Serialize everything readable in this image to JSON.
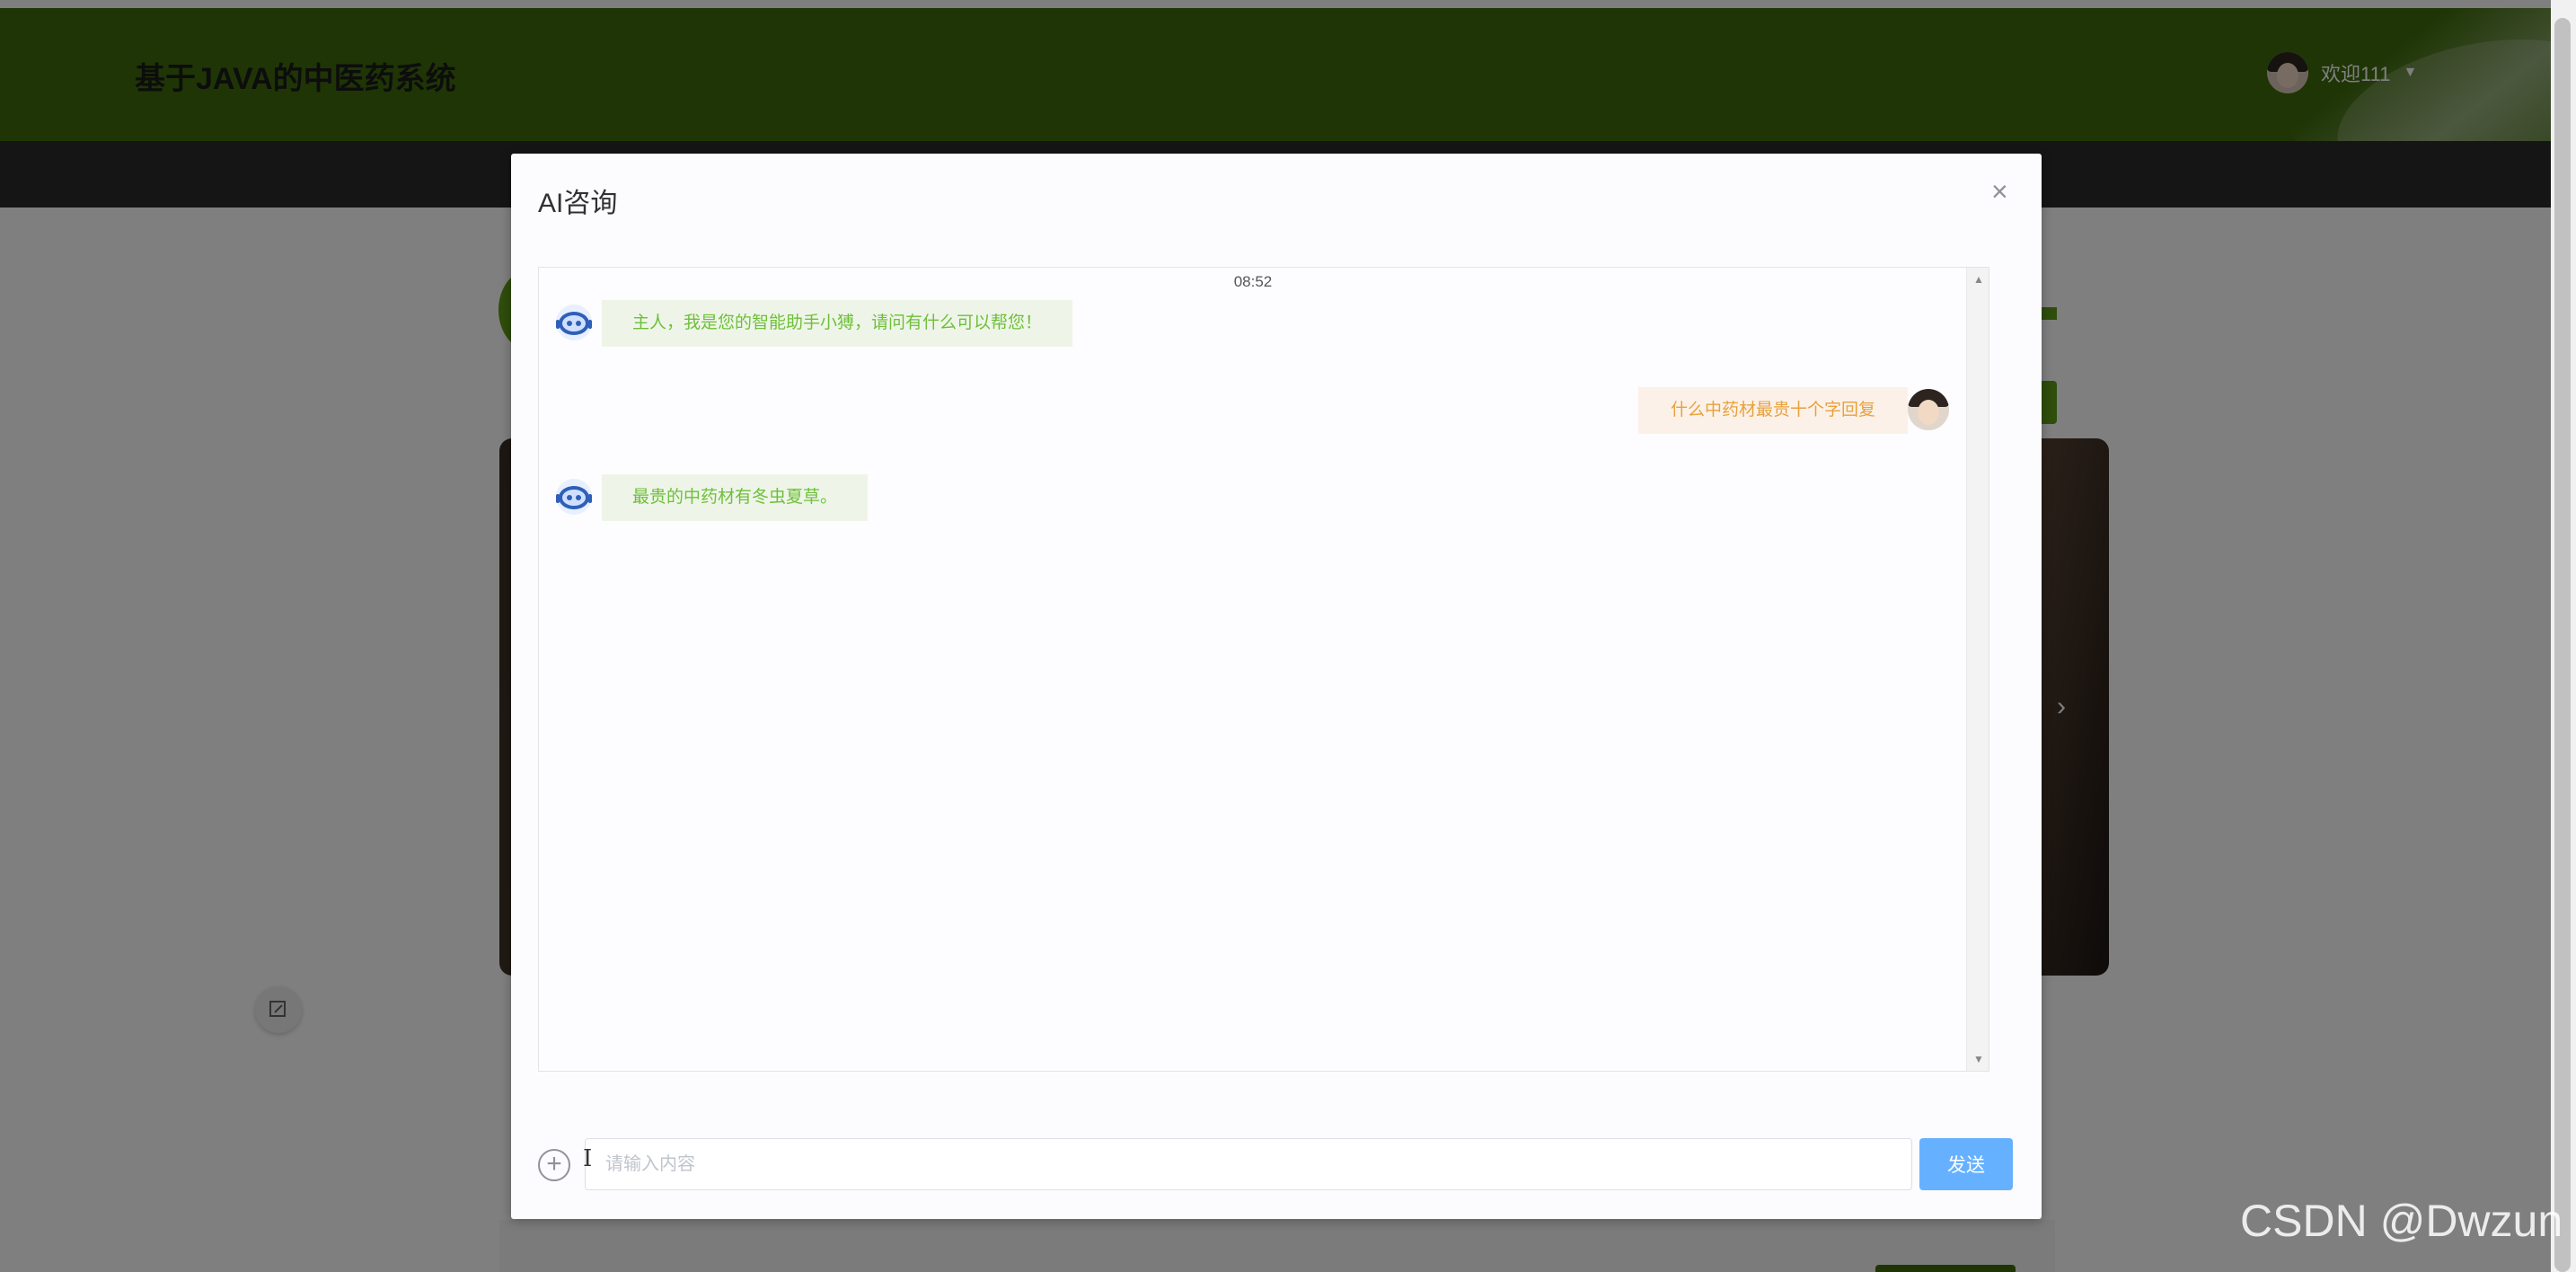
{
  "site": {
    "title": "基于JAVA的中医药系统"
  },
  "user": {
    "greeting": "欢迎111",
    "caret": "▼"
  },
  "banner": {
    "next_arrow": "›"
  },
  "dialog": {
    "title": "AI咨询",
    "close_glyph": "×",
    "chat": {
      "time": "08:52",
      "messages": [
        {
          "role": "bot",
          "text": "主人，我是您的智能助手小猼，请问有什么可以帮您！"
        },
        {
          "role": "user",
          "text": "什么中药材最贵十个字回复"
        },
        {
          "role": "bot",
          "text": "最贵的中药材有冬虫夏草。"
        }
      ]
    },
    "input": {
      "placeholder": "请输入内容",
      "value": ""
    },
    "send_label": "发送",
    "plus_glyph": "+"
  },
  "watermark": "CSDN @Dwzun",
  "colors": {
    "header": "#3f6b0c",
    "accent_green": "#5e9a16",
    "send": "#66b1ff",
    "bot_text": "#6fbf3a",
    "user_text": "#e8a13b"
  },
  "icons": {
    "bot_avatar": "robot-icon",
    "plus": "plus-circle-icon",
    "close": "close-icon",
    "edit": "edit-icon"
  }
}
